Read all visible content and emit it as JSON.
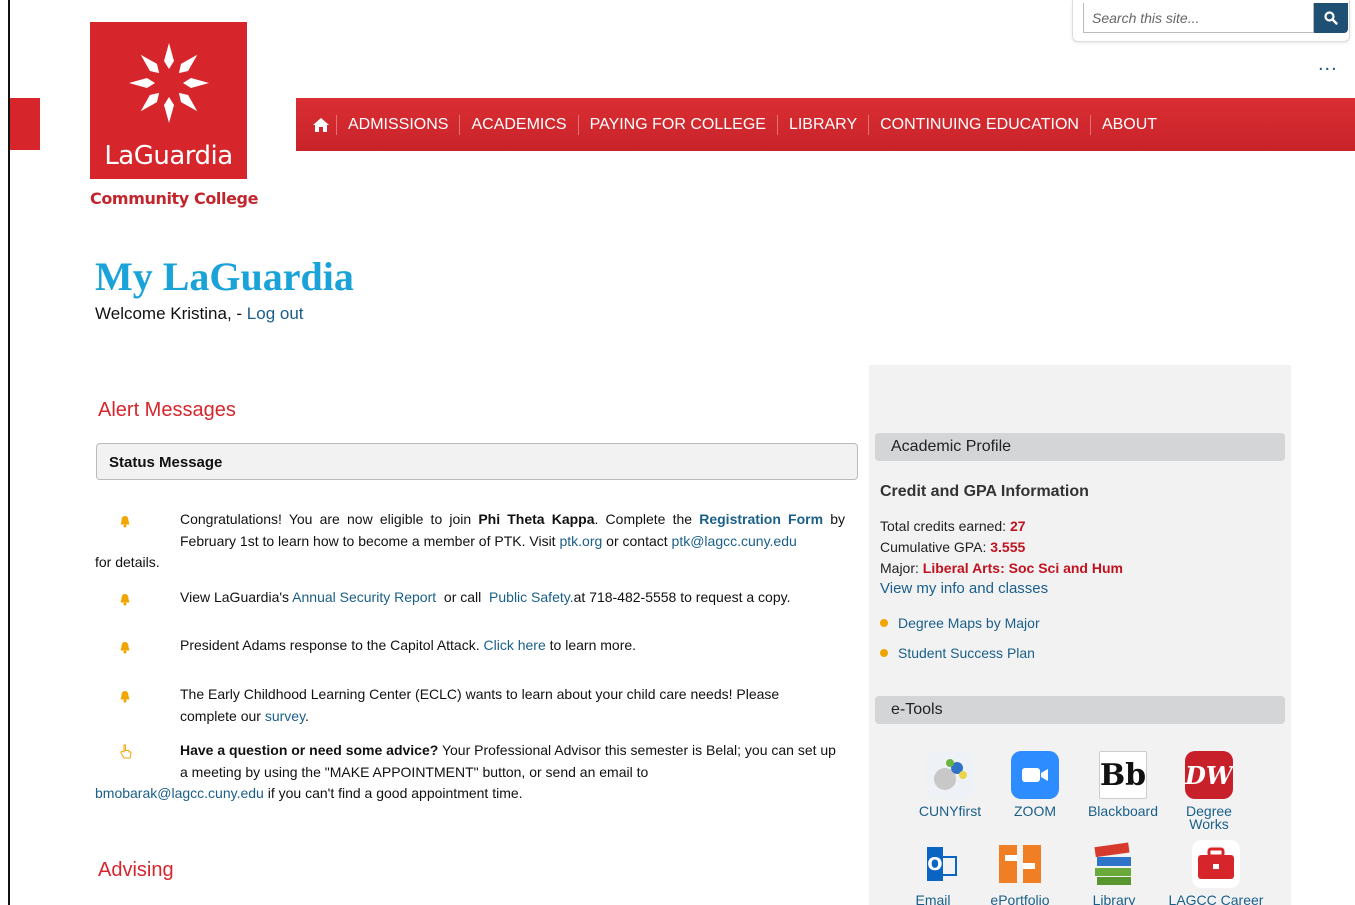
{
  "site": {
    "logo_word": "LaGuardia",
    "logo_sub": "Community College",
    "brand_red": "#d6262c",
    "link_blue": "#1a5f8a",
    "title_blue": "#1aa3d9"
  },
  "search": {
    "placeholder": "Search this site...",
    "more": "..."
  },
  "nav": {
    "home_icon": "home-icon",
    "items": [
      "ADMISSIONS",
      "ACADEMICS",
      "PAYING FOR COLLEGE",
      "LIBRARY",
      "CONTINUING EDUCATION",
      "ABOUT"
    ]
  },
  "page": {
    "title": "My LaGuardia",
    "welcome_prefix": "Welcome Kristina, - ",
    "logout": "Log out"
  },
  "alerts": {
    "heading": "Alert Messages",
    "status_title": "Status Message",
    "m1": {
      "t1": "Congratulations! You are now eligible to join ",
      "b1": "Phi Theta Kappa",
      "t2": ". Complete the ",
      "l1": "Registration Form",
      "t3": " by February 1st to learn how to become a member of PTK. Visit ",
      "l2": "ptk.org",
      "t4": " or contact ",
      "l3": "ptk@lagcc.cuny.edu",
      "tail": "for details."
    },
    "m2": {
      "t1": "View LaGuardia's ",
      "l1": "Annual Security Report",
      "t2": "  or call  ",
      "l2": "Public Safety.",
      "t3": "at 718-482-5558 to request a copy."
    },
    "m3": {
      "t1": "President Adams response to the Capitol Attack. ",
      "l1": "Click here",
      "t2": " to learn more."
    },
    "m4": {
      "t1": "The Early Childhood Learning Center (ECLC) wants to learn about your child care needs! Please complete our ",
      "l1": "survey",
      "t2": "."
    },
    "m5": {
      "b1": "Have a question or need some advice?",
      "t1": " Your Professional Advisor this semester is Belal; you can set up a meeting by using the \"MAKE APPOINTMENT\" button, or send an email to",
      "l1": "bmobarak@lagcc.cuny.edu",
      "t2": " if you can't find a good appointment time."
    }
  },
  "advising": {
    "heading": "Advising"
  },
  "profile": {
    "header": "Academic Profile",
    "credit_title": "Credit and GPA Information",
    "credits_label": "Total credits earned: ",
    "credits_value": "27",
    "gpa_label": "Cumulative GPA: ",
    "gpa_value": "3.555",
    "major_label": "Major: ",
    "major_value": "Liberal Arts: Soc Sci and Hum",
    "view_info": "View my info and classes",
    "links": [
      "Degree Maps by Major",
      "Student Success Plan"
    ]
  },
  "etools": {
    "header": "e-Tools",
    "tools": [
      {
        "label": "CUNYfirst",
        "icon": "cunyfirst-icon"
      },
      {
        "label": "ZOOM",
        "icon": "zoom-icon"
      },
      {
        "label": "Blackboard",
        "icon": "blackboard-icon",
        "glyph": "Bb"
      },
      {
        "label": "Degree Works",
        "icon": "degreeworks-icon",
        "glyph": "DW"
      },
      {
        "label": "Email",
        "icon": "outlook-email-icon",
        "glyph": "O"
      },
      {
        "label": "ePortfolio",
        "icon": "eportfolio-icon"
      },
      {
        "label": "Library",
        "icon": "library-books-icon"
      },
      {
        "label": "LAGCC Career",
        "icon": "career-briefcase-icon"
      }
    ]
  }
}
